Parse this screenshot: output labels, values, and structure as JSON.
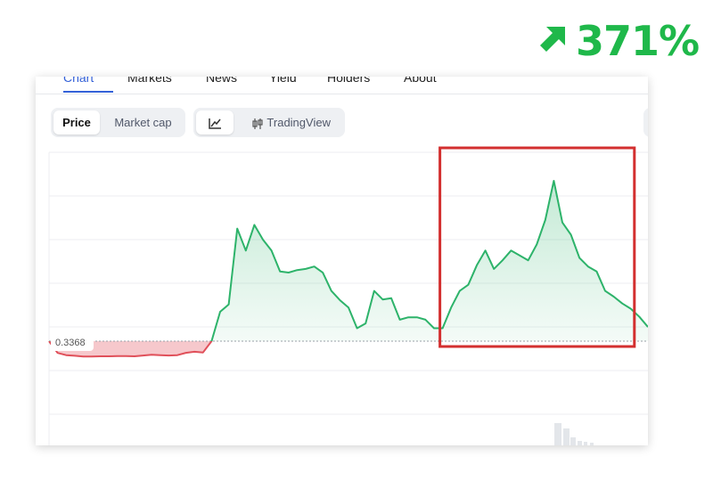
{
  "badge": {
    "percent": "371%",
    "icon": "arrow-up-right-icon",
    "color": "#1fb84a"
  },
  "tabs": [
    {
      "label": "Chart",
      "active": true
    },
    {
      "label": "Markets",
      "active": false
    },
    {
      "label": "News",
      "active": false
    },
    {
      "label": "Yield",
      "active": false
    },
    {
      "label": "Holders",
      "active": false
    },
    {
      "label": "About",
      "active": false
    }
  ],
  "toolbar": {
    "metric_options": [
      {
        "label": "Price",
        "selected": true
      },
      {
        "label": "Market cap",
        "selected": false
      }
    ],
    "line_chart_icon": "line-chart-icon",
    "tradingview_icon": "candlestick-icon",
    "tradingview_label": "TradingView"
  },
  "chart_data": {
    "type": "area",
    "reference_value": "0.3368",
    "baseline_label": "0.3368",
    "below_color": "#e0505a",
    "above_color": "#2db36a",
    "series": [
      {
        "values": [
          0.3368,
          0.318,
          0.3145,
          0.3134,
          0.3123,
          0.3123,
          0.3126,
          0.3126,
          0.3128,
          0.3128,
          0.3126,
          0.3139,
          0.3152,
          0.3145,
          0.3139,
          0.3145,
          0.3182,
          0.3198,
          0.3187,
          0.3368,
          0.3838,
          0.3955,
          0.5168,
          0.4816,
          0.5227,
          0.4992,
          0.4816,
          0.4484,
          0.4465,
          0.4504,
          0.4523,
          0.4562,
          0.4464,
          0.4171,
          0.4023,
          0.3906,
          0.3574,
          0.3652,
          0.4172,
          0.4035,
          0.4055,
          0.3711,
          0.375,
          0.375,
          0.3711,
          0.3574,
          0.3574,
          0.3906,
          0.4172,
          0.4269,
          0.4581,
          0.4816,
          0.4523,
          0.466,
          0.4816,
          0.4738,
          0.466,
          0.4913,
          0.5305,
          0.5932,
          0.5266,
          0.507,
          0.4699,
          0.4562,
          0.4484,
          0.4171,
          0.408,
          0.3971,
          0.3887,
          0.3757,
          0.3594
        ]
      }
    ],
    "highlight": {
      "color": "#d32f2f",
      "start_index": 46,
      "end_index": 68
    }
  }
}
